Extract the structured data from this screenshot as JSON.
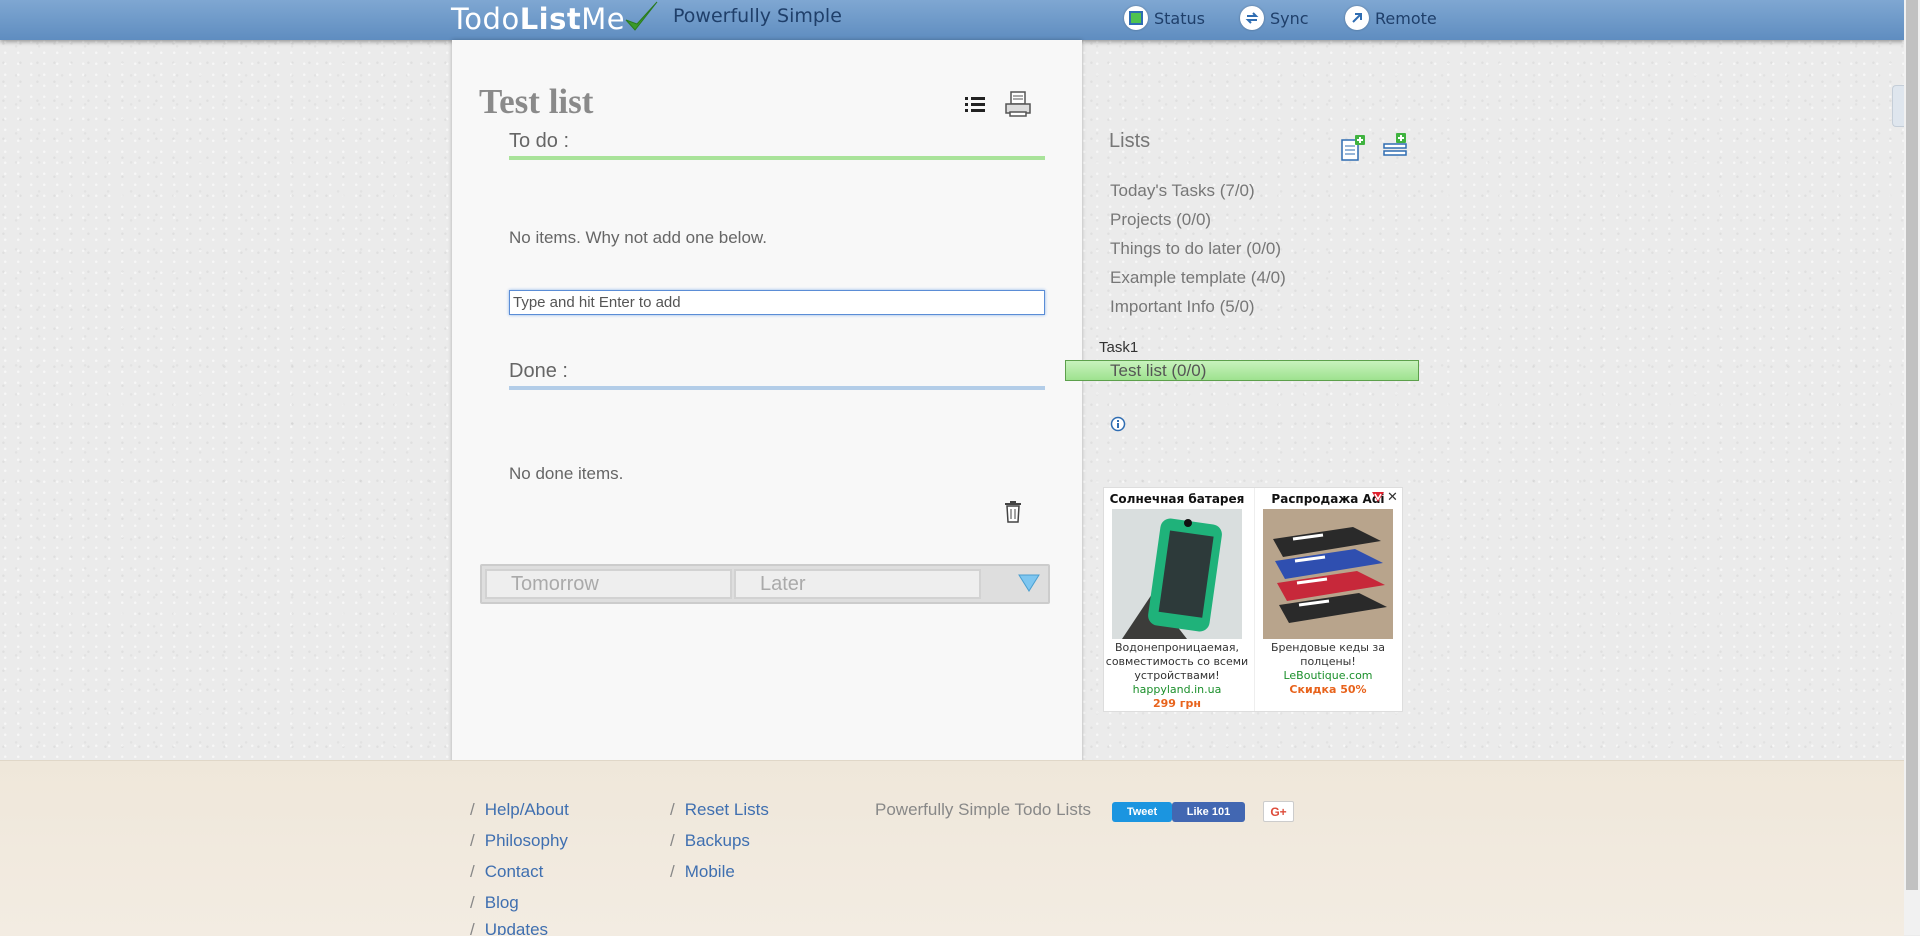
{
  "header": {
    "logo_prefix": "Todo",
    "logo_bold": "List",
    "logo_suffix": "Me",
    "tagline": "Powerfully Simple",
    "nav": [
      {
        "label": "Status",
        "icon": "status-icon"
      },
      {
        "label": "Sync",
        "icon": "sync-icon"
      },
      {
        "label": "Remote",
        "icon": "remote-icon"
      }
    ]
  },
  "list": {
    "title": "Test list",
    "todo_heading": "To do :",
    "todo_empty": "No items. Why not add one below.",
    "input_placeholder": "Type and hit Enter to add",
    "done_heading": "Done :",
    "done_empty": "No done items.",
    "buckets": [
      "Tomorrow",
      "Later"
    ]
  },
  "sidebar": {
    "title": "Lists",
    "lists": [
      "Today's Tasks (7/0)",
      "Projects (0/0)",
      "Things to do later (0/0)",
      "Example template (4/0)",
      "Important Info (5/0)"
    ],
    "category": "Task1",
    "active_list": "Test list (0/0)"
  },
  "ad": {
    "cards": [
      {
        "title": "Солнечная батарея",
        "text": "Водонепроницаемая, совместимость со всеми устройствами!",
        "domain": "happyland.in.ua",
        "price": "299 грн"
      },
      {
        "title": "Распродажа Adi",
        "text": "Брендовые кеды за полцены!",
        "domain": "LeBoutique.com",
        "price": "Скидка 50%"
      }
    ],
    "close": "✕"
  },
  "footer": {
    "col1": [
      "Help/About",
      "Philosophy",
      "Contact",
      "Blog",
      "Updates"
    ],
    "col2": [
      "Reset Lists",
      "Backups",
      "Mobile"
    ],
    "slash": "/",
    "tagline": "Powerfully Simple Todo Lists",
    "tweet": "Tweet",
    "like": "Like 101",
    "gplus": "G+"
  },
  "colors": {
    "header_blue": "#6a96c8",
    "todo_rule": "#a9e39a",
    "done_rule": "#b3cde8",
    "active_list_green": "#b3ebA6",
    "link_blue": "#3f6fb0"
  }
}
